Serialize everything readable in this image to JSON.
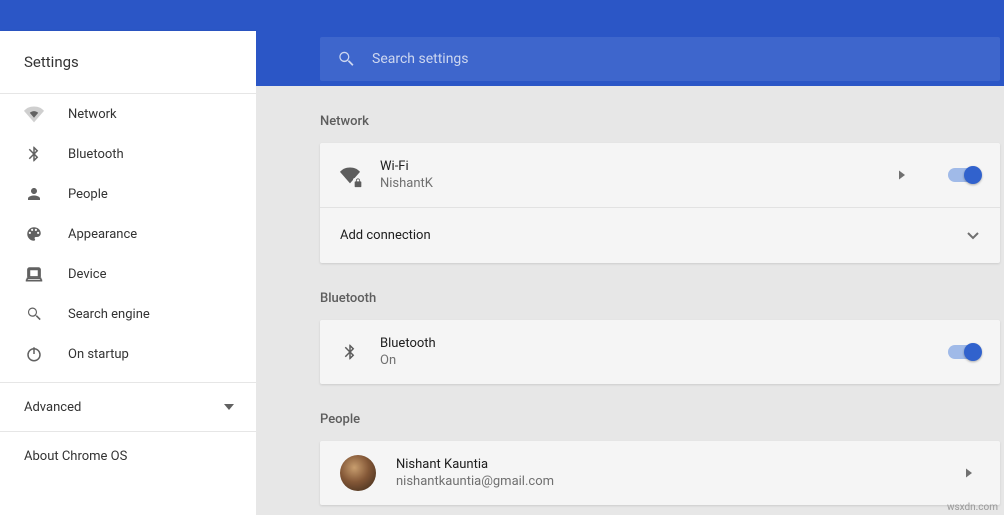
{
  "sidebar": {
    "title": "Settings",
    "items": [
      {
        "label": "Network",
        "icon": "wifi"
      },
      {
        "label": "Bluetooth",
        "icon": "bluetooth"
      },
      {
        "label": "People",
        "icon": "person"
      },
      {
        "label": "Appearance",
        "icon": "palette"
      },
      {
        "label": "Device",
        "icon": "laptop"
      },
      {
        "label": "Search engine",
        "icon": "search"
      },
      {
        "label": "On startup",
        "icon": "power"
      }
    ],
    "advanced_label": "Advanced",
    "about_label": "About Chrome OS"
  },
  "search": {
    "placeholder": "Search settings"
  },
  "sections": {
    "network": {
      "title": "Network",
      "wifi": {
        "label": "Wi-Fi",
        "name": "NishantK",
        "enabled": true
      },
      "add_connection_label": "Add connection"
    },
    "bluetooth": {
      "title": "Bluetooth",
      "row": {
        "label": "Bluetooth",
        "status": "On",
        "enabled": true
      }
    },
    "people": {
      "title": "People",
      "user": {
        "name": "Nishant Kauntia",
        "email": "nishantkauntia@gmail.com"
      }
    }
  },
  "attribution": "wsxdn.com"
}
